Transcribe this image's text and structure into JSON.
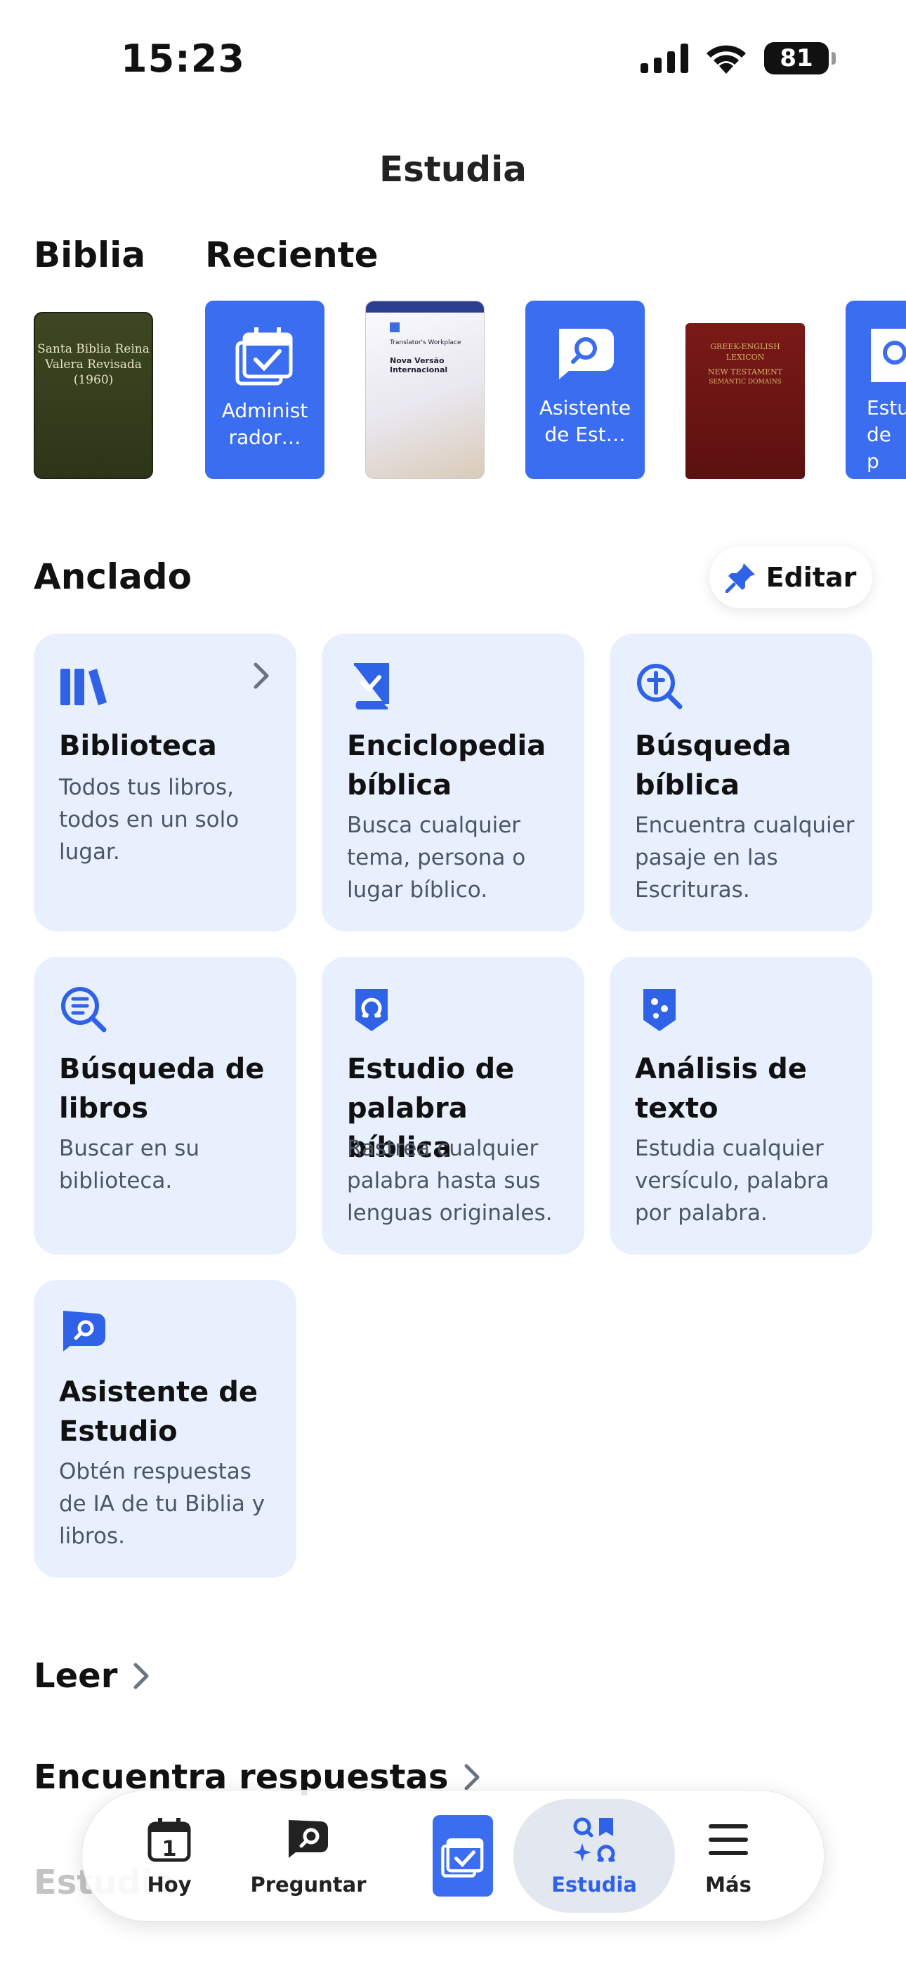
{
  "status": {
    "time": "15:23",
    "battery": "81"
  },
  "header": {
    "title": "Estudia"
  },
  "sections": {
    "bible": "Biblia",
    "recent": "Reciente",
    "pinned": "Anclado",
    "edit": "Editar"
  },
  "bible_cover": {
    "line1": "Santa Biblia Reina",
    "line2": "Valera Revisada",
    "line3": "(1960)"
  },
  "recent": [
    {
      "label1": "Administ",
      "label2": "rador…",
      "icon": "calendar-check-icon"
    },
    {
      "cover_top": "Translator's Workplace",
      "cover_title1": "Nova Versão",
      "cover_title2": "Internacional"
    },
    {
      "label1": "Asistente",
      "label2": "de Est…",
      "icon": "chat-search-icon"
    },
    {
      "cover1": "GREEK-ENGLISH",
      "cover2": "LEXICON",
      "cover3": "NEW TESTAMENT",
      "cover4": "SEMANTIC DOMAINS"
    },
    {
      "label1": "Estu",
      "label2": "de p",
      "icon": "omega-icon"
    }
  ],
  "cards": [
    {
      "title": "Biblioteca",
      "desc": "Todos tus libros, todos en un solo lugar.",
      "icon": "library-books-icon"
    },
    {
      "title": "Enciclopedia bíblica",
      "desc": "Busca cualquier tema, persona o lugar bíblico.",
      "icon": "book-check-icon"
    },
    {
      "title": "Búsqueda bíblica",
      "desc": "Encuentra cualquier pasaje en las Escrituras.",
      "icon": "cross-search-icon"
    },
    {
      "title": "Búsqueda de libros",
      "desc": "Buscar en su biblioteca.",
      "icon": "list-search-icon"
    },
    {
      "title": "Estudio de palabra bíblica",
      "desc": "Rastrea cualquier palabra hasta sus lenguas originales.",
      "icon": "omega-shield-icon"
    },
    {
      "title": "Análisis de texto",
      "desc": "Estudia cualquier versículo, palabra por palabra.",
      "icon": "text-analysis-icon"
    },
    {
      "title": "Asistente de Estudio",
      "desc": "Obtén respuestas de IA de tu Biblia y libros.",
      "icon": "chat-search-icon"
    }
  ],
  "links": {
    "read": "Leer",
    "answers": "Encuentra respuestas",
    "study": "Estudia"
  },
  "tabs": [
    {
      "label": "Hoy",
      "icon": "calendar-day-icon"
    },
    {
      "label": "Preguntar",
      "icon": "chat-search-icon"
    },
    {
      "label": "",
      "icon": "calendar-check-icon"
    },
    {
      "label": "Estudia",
      "icon": "study-tools-icon"
    },
    {
      "label": "Más",
      "icon": "menu-icon"
    }
  ],
  "colors": {
    "accent": "#3a6df0",
    "card_bg": "#e8f0fe",
    "active_tab": "#2f62e6"
  }
}
